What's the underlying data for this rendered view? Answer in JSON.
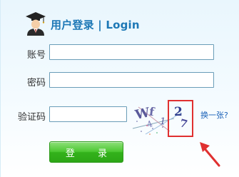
{
  "header": {
    "title": "用户登录 | Login"
  },
  "form": {
    "account_label": "账号",
    "account_value": "",
    "password_label": "密码",
    "password_value": "",
    "captcha_label": "验证码",
    "captcha_value": "",
    "captcha_swap_label": "换一张?",
    "login_label": "登 录"
  },
  "captcha_image": {
    "chars": [
      "W",
      "f",
      "4",
      "1",
      "2",
      "7"
    ],
    "highlight_color": "#e03030"
  },
  "colors": {
    "accent": "#1d78b6",
    "button_green": "#33b21b",
    "annotation_red": "#e03030"
  }
}
